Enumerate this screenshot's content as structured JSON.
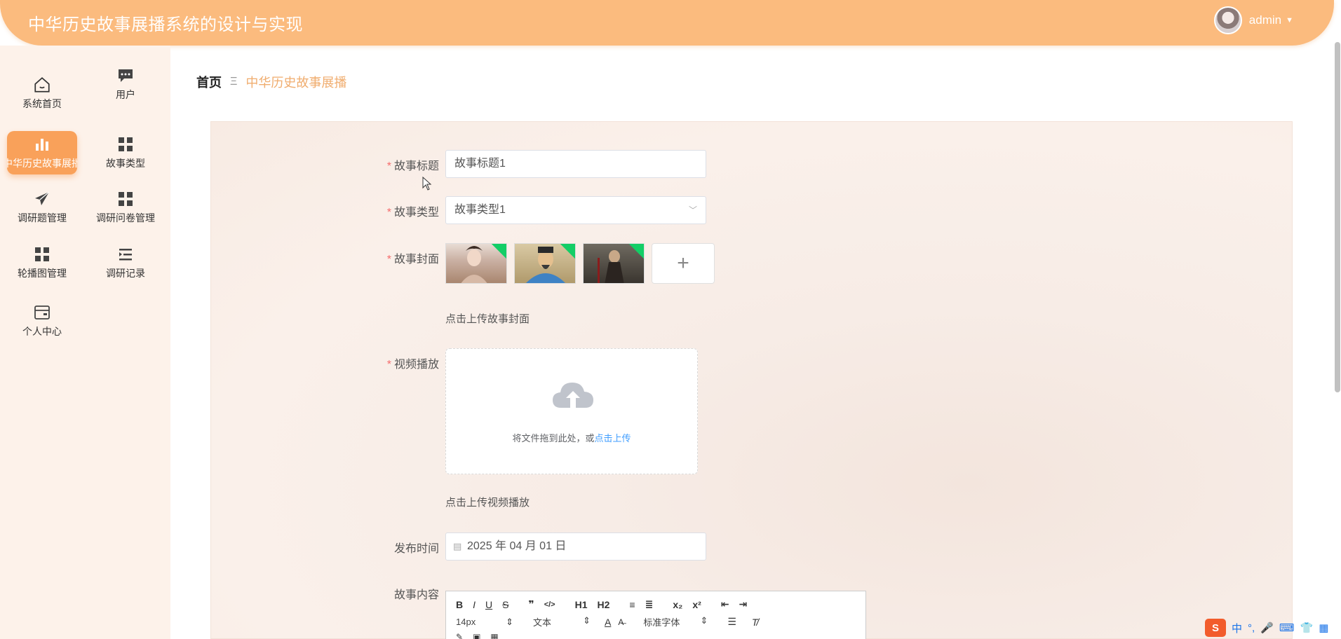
{
  "header": {
    "title": "中华历史故事展播系统的设计与实现",
    "username": "admin"
  },
  "sidebar": {
    "items": [
      {
        "label": "系统首页",
        "icon": "home-icon"
      },
      {
        "label": "用户",
        "icon": "chat-icon"
      },
      {
        "label": "中华历史故事展播",
        "icon": "bar-chart-icon",
        "active": true
      },
      {
        "label": "故事类型",
        "icon": "grid-icon"
      },
      {
        "label": "调研题管理",
        "icon": "send-icon"
      },
      {
        "label": "调研问卷管理",
        "icon": "grid-icon"
      },
      {
        "label": "轮播图管理",
        "icon": "grid-icon"
      },
      {
        "label": "调研记录",
        "icon": "list-icon"
      },
      {
        "label": "个人中心",
        "icon": "wallet-icon"
      }
    ]
  },
  "breadcrumb": {
    "home": "首页",
    "separator": "Ξ",
    "current": "中华历史故事展播"
  },
  "form": {
    "title_label": "故事标题",
    "title_value": "故事标题1",
    "type_label": "故事类型",
    "type_value": "故事类型1",
    "cover_label": "故事封面",
    "cover_hint": "点击上传故事封面",
    "video_label": "视频播放",
    "upload_text": "将文件拖到此处，或",
    "upload_link": "点击上传",
    "video_hint": "点击上传视频播放",
    "date_label": "发布时间",
    "date_value": "2025 年 04 月 01 日",
    "content_label": "故事内容"
  },
  "editor": {
    "buttons_row1": [
      "B",
      "I",
      "U",
      "S",
      "❞",
      "</>",
      "H1",
      "H2",
      "≡",
      "≣",
      "x₂",
      "x²",
      "⇤",
      "⇥"
    ],
    "font_size": "14px",
    "text_type": "文本",
    "font_family": "标准字体"
  },
  "ime": {
    "lang": "中"
  },
  "colors": {
    "accent": "#f9a15a",
    "header": "#fbbb7e",
    "required": "#f56c6c",
    "link": "#409eff"
  }
}
